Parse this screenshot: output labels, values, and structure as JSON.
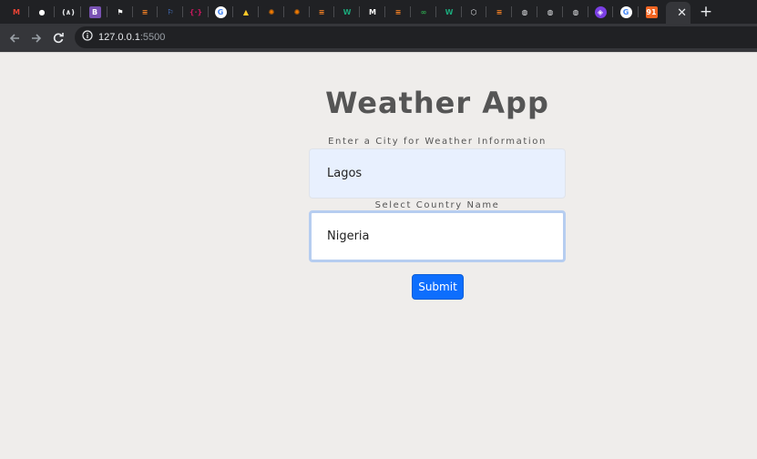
{
  "browser": {
    "tabs": [
      {
        "icon": "gmail-icon",
        "glyph": "M",
        "bg": "#202124",
        "fg": "#ea4335"
      },
      {
        "icon": "github-icon",
        "glyph": "●",
        "bg": "#202124",
        "fg": "#ffffff"
      },
      {
        "icon": "code-bracket-icon",
        "glyph": "(∧)",
        "bg": "#202124",
        "fg": "#e8eaed"
      },
      {
        "icon": "bootstrap-icon",
        "glyph": "B",
        "bg": "#7952b3",
        "fg": "#ffffff"
      },
      {
        "icon": "flag-icon",
        "glyph": "⚑",
        "bg": "#202124",
        "fg": "#ffffff"
      },
      {
        "icon": "stackoverflow-icon",
        "glyph": "≡",
        "bg": "#202124",
        "fg": "#f48024"
      },
      {
        "icon": "flag-outline-icon",
        "glyph": "⚐",
        "bg": "#202124",
        "fg": "#4f8ef7"
      },
      {
        "icon": "pink-bracket-icon",
        "glyph": "{·}",
        "bg": "#202124",
        "fg": "#c2185b"
      },
      {
        "icon": "google-icon",
        "glyph": "G",
        "bg": "#ffffff",
        "fg": "#4285f4",
        "round": true
      },
      {
        "icon": "firebase-icon",
        "glyph": "▲",
        "bg": "#202124",
        "fg": "#ffca28"
      },
      {
        "icon": "orange-gear-icon",
        "glyph": "✺",
        "bg": "#202124",
        "fg": "#f57c00"
      },
      {
        "icon": "orange-gear-icon-2",
        "glyph": "✺",
        "bg": "#202124",
        "fg": "#f57c00"
      },
      {
        "icon": "stackoverflow-icon-2",
        "glyph": "≡",
        "bg": "#202124",
        "fg": "#f48024"
      },
      {
        "icon": "w-green-icon",
        "glyph": "W",
        "bg": "#202124",
        "fg": "#1ba77a"
      },
      {
        "icon": "m-white-icon",
        "glyph": "M",
        "bg": "#202124",
        "fg": "#ffffff"
      },
      {
        "icon": "stackoverflow-icon-3",
        "glyph": "≡",
        "bg": "#202124",
        "fg": "#f48024"
      },
      {
        "icon": "green-wave-icon",
        "glyph": "∞",
        "bg": "#202124",
        "fg": "#2ea44f"
      },
      {
        "icon": "w-green-icon-2",
        "glyph": "W",
        "bg": "#202124",
        "fg": "#1ba77a"
      },
      {
        "icon": "cube-icon",
        "glyph": "⬡",
        "bg": "#202124",
        "fg": "#e8eaed"
      },
      {
        "icon": "stackoverflow-icon-4",
        "glyph": "≡",
        "bg": "#202124",
        "fg": "#f48024"
      },
      {
        "icon": "globe-icon",
        "glyph": "◍",
        "bg": "#202124",
        "fg": "#e8eaed"
      },
      {
        "icon": "globe-icon-2",
        "glyph": "◍",
        "bg": "#202124",
        "fg": "#e8eaed"
      },
      {
        "icon": "globe-icon-3",
        "glyph": "◍",
        "bg": "#202124",
        "fg": "#e8eaed"
      },
      {
        "icon": "purple-shield-icon",
        "glyph": "◈",
        "bg": "#7b3fe4",
        "fg": "#ffffff",
        "round": true
      },
      {
        "icon": "google-icon-2",
        "glyph": "G",
        "bg": "#ffffff",
        "fg": "#4285f4",
        "round": true
      },
      {
        "icon": "orange-91-icon",
        "glyph": "91",
        "bg": "#f26522",
        "fg": "#ffffff"
      }
    ],
    "url_host": "127.0.0.1",
    "url_port": ":5500"
  },
  "page": {
    "title": "Weather App",
    "city_label": "Enter a City for Weather Information",
    "city_value": "Lagos",
    "country_label": "Select Country Name",
    "country_value": "Nigeria",
    "submit_label": "Submit"
  }
}
